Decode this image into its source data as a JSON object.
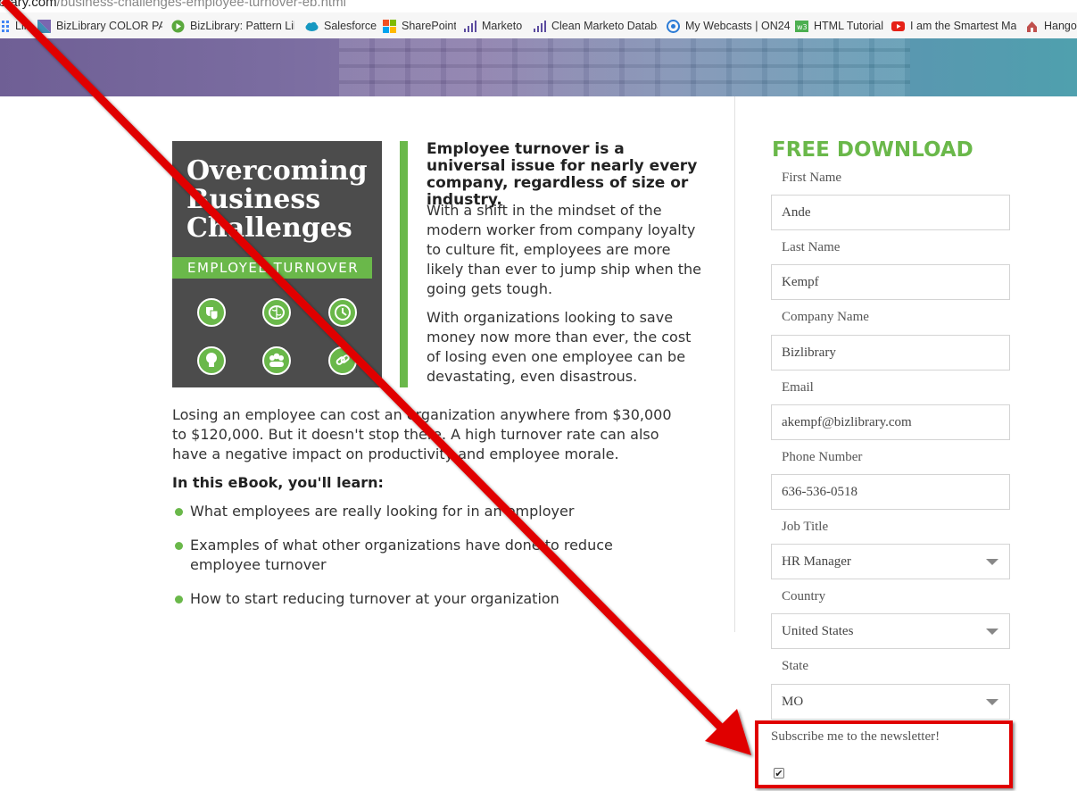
{
  "browser": {
    "url_host": "brary.com",
    "url_path": "/business-challenges-employee-turnover-eb.html",
    "bookmarks": [
      {
        "label": "Lin",
        "icon": "apps-icon",
        "color": "#4285f4"
      },
      {
        "label": "BizLibrary COLOR PAL",
        "icon": "bizlibrary-logo-icon",
        "color": "#5b4a8c"
      },
      {
        "label": "BizLibrary: Pattern Libr",
        "icon": "play-icon",
        "color": "#5aa83d"
      },
      {
        "label": "Salesforce",
        "icon": "cloud-icon",
        "color": "#1798c1"
      },
      {
        "label": "SharePoint",
        "icon": "windows-icon",
        "color": "#0078d4"
      },
      {
        "label": "Marketo",
        "icon": "bars-icon",
        "color": "#5c4c9f"
      },
      {
        "label": "Clean Marketo Databa",
        "icon": "bars-icon",
        "color": "#5c4c9f"
      },
      {
        "label": "My Webcasts | ON24",
        "icon": "webcast-icon",
        "color": "#2b7bd6"
      },
      {
        "label": "HTML Tutorial",
        "icon": "w3-icon",
        "color": "#4caf50"
      },
      {
        "label": "I am the Smartest Mar",
        "icon": "youtube-icon",
        "color": "#e62117"
      },
      {
        "label": "Hangou",
        "icon": "hangouts-icon",
        "color": "#b03030"
      }
    ]
  },
  "cover": {
    "title_lines": [
      "Overcoming",
      "Business",
      "Challenges"
    ],
    "band": "EMPLOYEE TURNOVER",
    "icons": [
      "theater-masks-icon",
      "brain-icon",
      "clock-icon",
      "lightbulb-icon",
      "team-icon",
      "link-icon"
    ]
  },
  "content": {
    "lead": "Employee turnover is a universal issue for nearly every company, regardless of size or industry.",
    "para1": "With a shift in the mindset of the modern worker from company loyalty to culture fit, employees are more likely than ever to jump ship when the going gets tough.",
    "para2": "With organizations looking to save money now more than ever, the cost of losing even one employee can be devastating, even disastrous.",
    "body": "Losing an employee can cost an organization anywhere from $30,000 to $120,000. But it doesn't stop there. A high turnover rate can also have a negative impact on productivity and employee morale.",
    "learn_heading": "In this eBook, you'll learn:",
    "bullets": [
      "What employees are really looking for in an employer",
      "Examples of what other organizations have done to reduce employee turnover",
      "How to start reducing turnover at your organization"
    ]
  },
  "form": {
    "title": "FREE DOWNLOAD",
    "first_name": {
      "label": "First Name",
      "value": "Ande"
    },
    "last_name": {
      "label": "Last Name",
      "value": "Kempf"
    },
    "company": {
      "label": "Company Name",
      "value": "Bizlibrary"
    },
    "email": {
      "label": "Email",
      "value": "akempf@bizlibrary.com"
    },
    "phone": {
      "label": "Phone Number",
      "value": "636-536-0518"
    },
    "job_title": {
      "label": "Job Title",
      "value": "HR Manager"
    },
    "country": {
      "label": "Country",
      "value": "United States"
    },
    "state": {
      "label": "State",
      "value": "MO"
    },
    "newsletter": {
      "label": "Subscribe me to the newsletter!",
      "checked": true
    }
  },
  "colors": {
    "accent_green": "#6ab84a",
    "annotation_red": "#e00000",
    "cover_gray": "#4c4c4c"
  }
}
